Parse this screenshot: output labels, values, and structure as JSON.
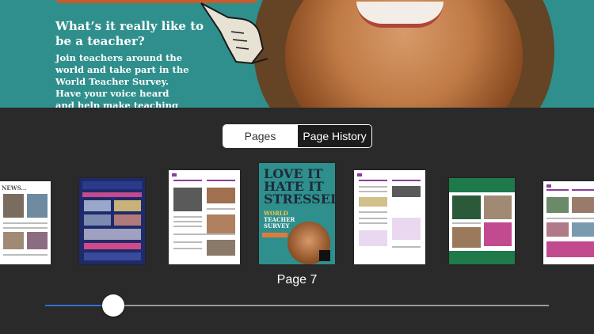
{
  "preview": {
    "headline": "What’s it really like to be a teacher?",
    "body": "Join teachers around the world and take part in the World Teacher Survey. Have your voice heard and help make teaching"
  },
  "segmented": {
    "pages": "Pages",
    "history": "Page History",
    "selected": "Page History"
  },
  "thumbnails": {
    "t1_title": "NEWS...",
    "t7_line1": "LOVE IT",
    "t7_line2": "HATE IT",
    "t7_line3": "STRESSED",
    "t7_survey_a": "WORLD",
    "t7_survey_b": "TEACHER",
    "t7_survey_c": "SURVEY"
  },
  "page_label": "Page 7",
  "slider": {
    "value": 7,
    "fraction": 0.135
  },
  "colors": {
    "accent": "#2f6fd6",
    "background": "#2a2a2a",
    "teal": "#2f8f8c"
  }
}
